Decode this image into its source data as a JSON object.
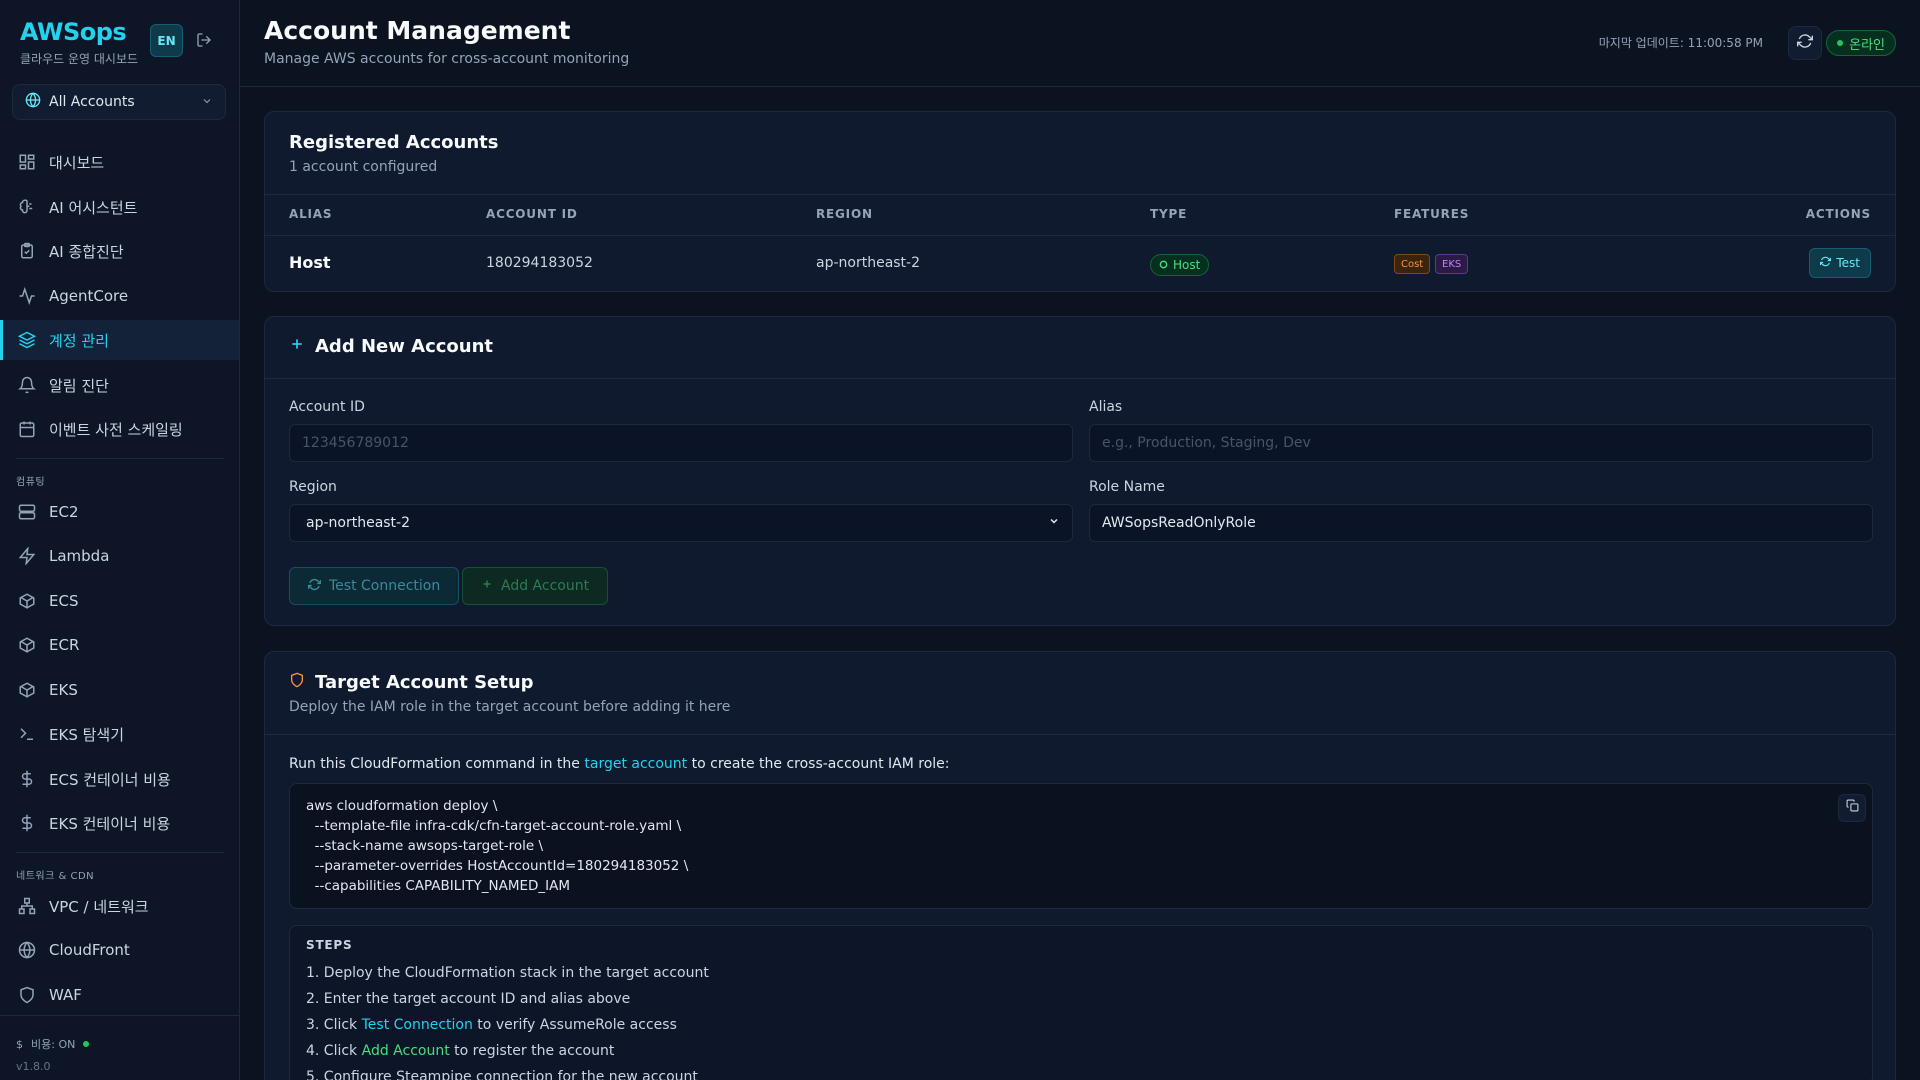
{
  "brand": {
    "title": "AWSops",
    "subtitle": "클라우드 운영 대시보드",
    "lang": "EN"
  },
  "account_selector": {
    "label": "All Accounts"
  },
  "sidebar": {
    "items": [
      {
        "label": "대시보드",
        "icon": "grid-icon"
      },
      {
        "label": "AI 어시스턴트",
        "icon": "brain-icon"
      },
      {
        "label": "AI 종합진단",
        "icon": "clipboard-icon"
      },
      {
        "label": "AgentCore",
        "icon": "activity-icon"
      },
      {
        "label": "계정 관리",
        "icon": "layers-icon",
        "active": true
      },
      {
        "label": "알림 진단",
        "icon": "bell-icon"
      },
      {
        "label": "이벤트 사전 스케일링",
        "icon": "calendar-icon"
      }
    ],
    "section_compute": "컴퓨팅",
    "compute_items": [
      {
        "label": "EC2",
        "icon": "server-icon"
      },
      {
        "label": "Lambda",
        "icon": "zap-icon"
      },
      {
        "label": "ECS",
        "icon": "box-icon"
      },
      {
        "label": "ECR",
        "icon": "box-icon"
      },
      {
        "label": "EKS",
        "icon": "box-icon"
      },
      {
        "label": "EKS 탐색기",
        "icon": "terminal-icon"
      },
      {
        "label": "ECS 컨테이너 비용",
        "icon": "dollar-icon"
      },
      {
        "label": "EKS 컨테이너 비용",
        "icon": "dollar-icon"
      }
    ],
    "section_network": "네트워크 & CDN",
    "network_items": [
      {
        "label": "VPC / 네트워크",
        "icon": "network-icon"
      },
      {
        "label": "CloudFront",
        "icon": "globe-icon"
      },
      {
        "label": "WAF",
        "icon": "shield-icon"
      }
    ],
    "footer": {
      "cost": "비용: ON",
      "version": "v1.8.0"
    }
  },
  "header": {
    "title": "Account Management",
    "subtitle": "Manage AWS accounts for cross-account monitoring",
    "last_update": "마지막 업데이트: 11:00:58 PM",
    "status": "온라인"
  },
  "registered": {
    "title": "Registered Accounts",
    "subtitle": "1 account configured",
    "columns": [
      "ALIAS",
      "ACCOUNT ID",
      "REGION",
      "TYPE",
      "FEATURES",
      "ACTIONS"
    ],
    "rows": [
      {
        "alias": "Host",
        "account_id": "180294183052",
        "region": "ap-northeast-2",
        "type": "Host",
        "features": [
          "Cost",
          "EKS"
        ],
        "action": "Test"
      }
    ]
  },
  "add_account": {
    "title": "Add New Account",
    "account_id_label": "Account ID",
    "account_id_placeholder": "123456789012",
    "alias_label": "Alias",
    "alias_placeholder": "e.g., Production, Staging, Dev",
    "region_label": "Region",
    "region_value": "ap-northeast-2",
    "role_label": "Role Name",
    "role_value": "AWSopsReadOnlyRole",
    "test_button": "Test Connection",
    "add_button": "Add Account"
  },
  "setup": {
    "title": "Target Account Setup",
    "subtitle": "Deploy the IAM role in the target account before adding it here",
    "run_prefix": "Run this CloudFormation command in the ",
    "run_link": "target account",
    "run_suffix": " to create the cross-account IAM role:",
    "code": [
      "aws cloudformation deploy \\",
      "  --template-file infra-cdk/cfn-target-account-role.yaml \\",
      "  --stack-name awsops-target-role \\",
      "  --parameter-overrides HostAccountId=180294183052 \\",
      "  --capabilities CAPABILITY_NAMED_IAM"
    ],
    "steps_title": "STEPS",
    "step1": "1. Deploy the CloudFormation stack in the target account",
    "step2": "2. Enter the target account ID and alias above",
    "step3_pre": "3. Click ",
    "step3_link": "Test Connection",
    "step3_post": " to verify AssumeRole access",
    "step4_pre": "4. Click ",
    "step4_link": "Add Account",
    "step4_post": " to register the account",
    "step5": "5. Configure Steampipe connection for the new account"
  },
  "colors": {
    "accent": "#22d3ee",
    "success": "#4ade80",
    "background": "#0b1220",
    "card": "#0f1a2e"
  }
}
